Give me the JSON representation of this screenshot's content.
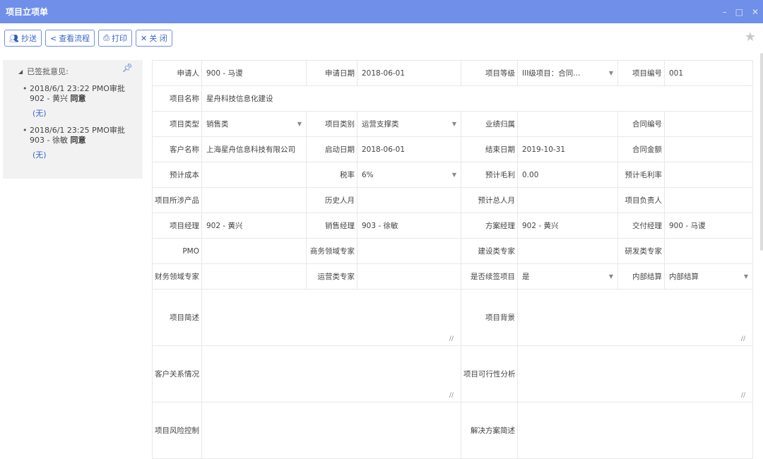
{
  "window": {
    "title": "项目立项单",
    "controls": [
      "–",
      "□",
      "✕"
    ]
  },
  "toolbar": {
    "buttons": [
      {
        "icon": "users-icon",
        "label": "抄送"
      },
      {
        "icon": "share-icon",
        "label": "查看流程"
      },
      {
        "icon": "print-icon",
        "label": "打印"
      },
      {
        "icon": "close-icon",
        "label": "关 闭"
      }
    ]
  },
  "approvals": {
    "heading": "已签批意见:",
    "items": [
      {
        "line1": "2018/6/1 23:22 PMO审批",
        "who": "902 - 黄兴",
        "result": "同意",
        "comment": "(无)"
      },
      {
        "line1": "2018/6/1 23:25 PMO审批",
        "who": "903 - 徐敏",
        "result": "同意",
        "comment": "(无)"
      }
    ]
  },
  "form": {
    "applicant_label": "申请人",
    "applicant": "900 - 马谡",
    "apply_date_label": "申请日期",
    "apply_date": "2018-06-01",
    "level_label": "项目等级",
    "level": "III级项目：合同...",
    "code_label": "项目编号",
    "code": "001",
    "name_label": "项目名称",
    "name": "星舟科技信息化建设",
    "type_label": "项目类型",
    "type": "销售类",
    "category_label": "项目类别",
    "category": "运营支撑类",
    "perf_label": "业绩归属",
    "perf": "",
    "contract_no_label": "合同编号",
    "contract_no": "",
    "customer_label": "客户名称",
    "customer": "上海星舟信息科技有限公司",
    "start_label": "启动日期",
    "start": "2018-06-01",
    "end_label": "结束日期",
    "end": "2019-10-31",
    "contract_amt_label": "合同金额",
    "contract_amt": "",
    "cost_label": "预计成本",
    "cost": "",
    "tax_label": "税率",
    "tax": "6%",
    "gross_label": "预计毛利",
    "gross": "0.00",
    "gross_rate_label": "预计毛利率",
    "gross_rate": "",
    "products_label": "项目所涉产品",
    "products": "",
    "hist_label": "历史人月",
    "hist": "",
    "total_label": "预计总人月",
    "total": "",
    "owner_label": "项目负责人",
    "owner": "",
    "pm_label": "项目经理",
    "pm": "902 - 黄兴",
    "sales_label": "销售经理",
    "sales": "903 - 徐敏",
    "solution_label": "方案经理",
    "solution": "902 - 黄兴",
    "delivery_label": "交付经理",
    "delivery": "900 - 马谡",
    "pmo_label": "PMO",
    "pmo": "",
    "biz_label": "商务领域专家",
    "biz": "",
    "build_label": "建设类专家",
    "build": "",
    "rd_label": "研发类专家",
    "rd": "",
    "fin_label": "财务领域专家",
    "fin": "",
    "ops_label": "运营类专家",
    "ops": "",
    "renew_label": "是否续签项目",
    "renew": "是",
    "internal_label": "内部结算",
    "internal": "内部结算",
    "brief_label": "项目简述",
    "background_label": "项目背景",
    "relation_label": "客户关系情况",
    "feasibility_label": "项目可行性分析",
    "risk_label": "项目风险控制",
    "solution_brief_label": "解决方案简述"
  }
}
